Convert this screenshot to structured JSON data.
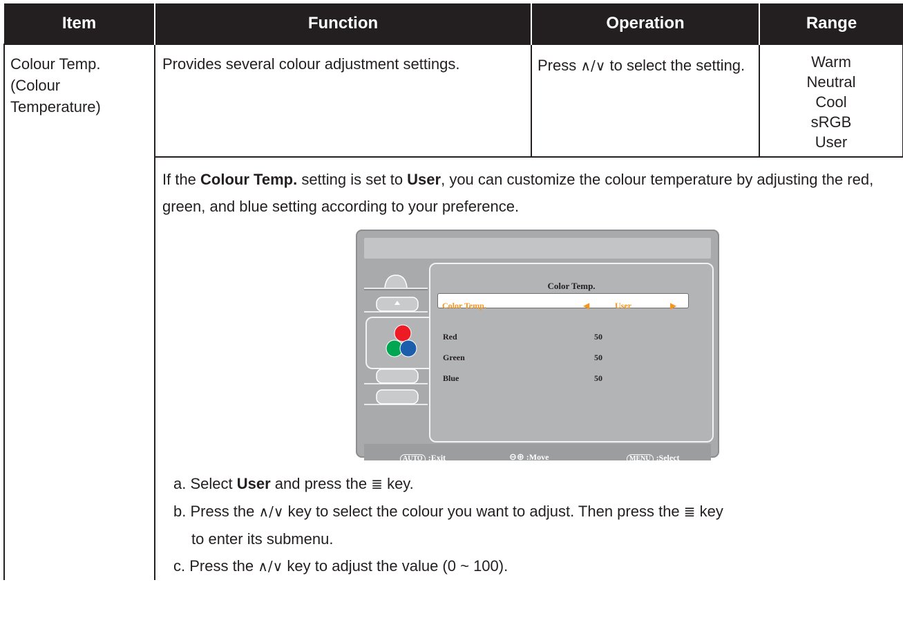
{
  "header": {
    "item": "Item",
    "function": "Function",
    "operation": "Operation",
    "range": "Range"
  },
  "row": {
    "item_lines": [
      "Colour Temp.",
      "(Colour",
      "Temperature)"
    ],
    "function": "Provides several colour adjustment settings.",
    "operation_part1": "Press ",
    "operation_symbol": "∧/∨",
    "operation_part2": " to select the setting.",
    "range_values": [
      "Warm",
      "Neutral",
      "Cool",
      "sRGB",
      "User"
    ]
  },
  "detail": {
    "intro_1": "If the ",
    "intro_bold_1": "Colour Temp.",
    "intro_2": " setting is set to ",
    "intro_bold_2": "User",
    "intro_3": ", you can customize the colour temperature by adjusting the red, green, and blue setting according to your preference."
  },
  "osd": {
    "title": "Color Temp.",
    "selected_label": "Color Temp.",
    "selected_value": "User",
    "rows": [
      {
        "label": "Red",
        "value": "50"
      },
      {
        "label": "Green",
        "value": "50"
      },
      {
        "label": "Blue",
        "value": "50"
      }
    ],
    "footer": {
      "exit_key": "AUTO",
      "exit_label": ":Exit",
      "move_label": ":Move",
      "select_key": "MENU",
      "select_label": ":Select"
    },
    "colors": {
      "highlight": "#f7941d",
      "panel": "#b3b4b6",
      "frame": "#a9aaac"
    }
  },
  "steps": {
    "a_prefix": "a. Select ",
    "a_bold": "User",
    "a_mid": " and press the ",
    "a_suffix": " key.",
    "b_prefix": "b. Press the ",
    "b_mid": " key to select the colour you want to adjust. Then press the ",
    "b_suffix": " key",
    "b_line2": "to enter its submenu.",
    "c_prefix": "c. Press the ",
    "c_suffix": " key to adjust the value (0 ~ 100).",
    "updown_symbol": "∧/∨",
    "menu_symbol": "≣"
  }
}
